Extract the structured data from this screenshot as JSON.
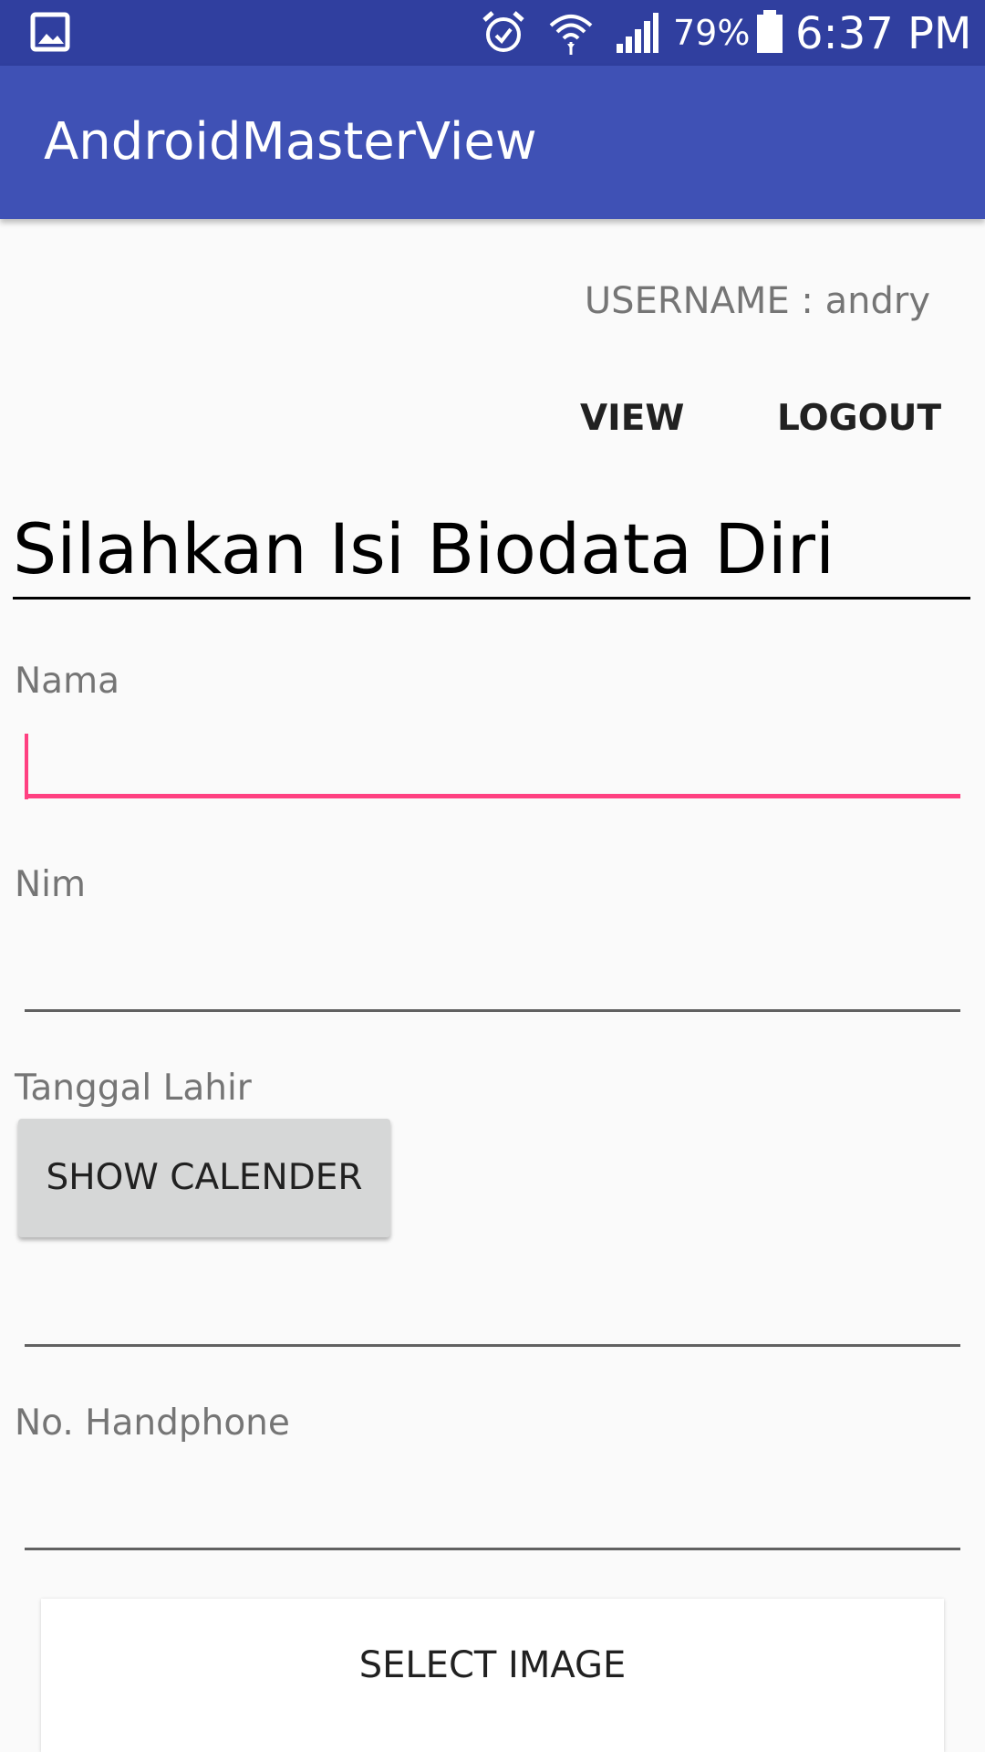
{
  "status_bar": {
    "gallery_icon": "gallery-notification-icon",
    "alarm_icon": "alarm-icon",
    "wifi_icon": "wifi-icon",
    "signal_icon": "signal-icon",
    "battery_icon": "battery-icon",
    "battery_percent": "79%",
    "time": "6:37 PM"
  },
  "app_bar": {
    "title": "AndroidMasterView"
  },
  "header": {
    "username_text": "USERNAME : andry",
    "view_label": "VIEW",
    "logout_label": "LOGOUT"
  },
  "form": {
    "heading": "Silahkan Isi Biodata Diri",
    "nama_label": "Nama",
    "nama_value": "",
    "nim_label": "Nim",
    "nim_value": "",
    "tanggal_label": "Tanggal Lahir",
    "show_calendar_label": "SHOW CALENDER",
    "tanggal_value": "",
    "hp_label": "No. Handphone",
    "hp_value": "",
    "select_image_label": "SELECT IMAGE"
  },
  "colors": {
    "status_bar": "#303f9f",
    "app_bar": "#3f51b5",
    "accent": "#ff4081",
    "background": "#fafafa"
  }
}
